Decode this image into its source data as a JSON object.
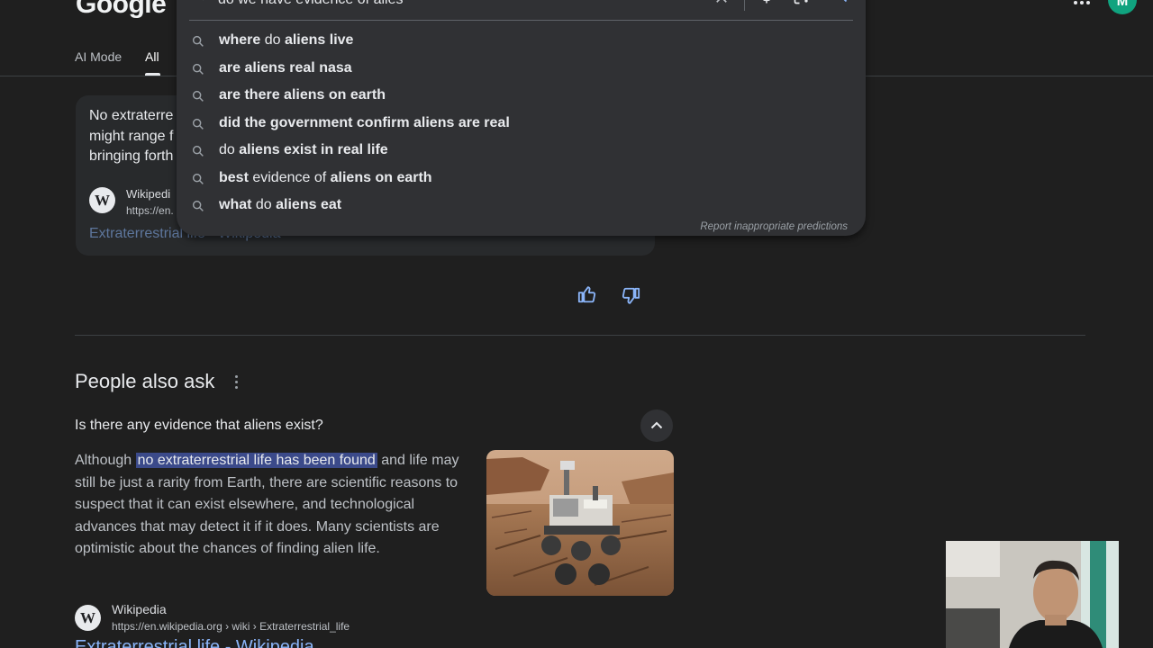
{
  "header": {
    "logo_text": "Google",
    "avatar_initial": "M"
  },
  "tabs": [
    {
      "label": "AI Mode"
    },
    {
      "label": "All"
    }
  ],
  "search": {
    "query": "do we have evidence of alies"
  },
  "suggestions": [
    {
      "parts": [
        {
          "t": "where",
          "b": true
        },
        {
          "t": " do ",
          "b": false
        },
        {
          "t": "aliens live",
          "b": true
        }
      ]
    },
    {
      "parts": [
        {
          "t": "are aliens real nasa",
          "b": true
        }
      ]
    },
    {
      "parts": [
        {
          "t": "are there aliens on earth",
          "b": true
        }
      ]
    },
    {
      "parts": [
        {
          "t": "did the government confirm aliens are real",
          "b": true
        }
      ]
    },
    {
      "parts": [
        {
          "t": "do ",
          "b": false
        },
        {
          "t": "aliens exist in real life",
          "b": true
        }
      ]
    },
    {
      "parts": [
        {
          "t": "best",
          "b": true
        },
        {
          "t": " evidence of ",
          "b": false
        },
        {
          "t": "aliens on earth",
          "b": true
        }
      ]
    },
    {
      "parts": [
        {
          "t": "what",
          "b": true
        },
        {
          "t": " do ",
          "b": false
        },
        {
          "t": "aliens eat",
          "b": true
        }
      ]
    }
  ],
  "report_text": "Report inappropriate predictions",
  "ai_overview": {
    "lines": [
      "No extraterre",
      "might range f",
      "bringing forth"
    ],
    "source_name": "Wikipedi",
    "source_url": "https://en.",
    "link_text": "Extraterrestrial life - Wikipedia"
  },
  "people_also_ask": {
    "title": "People also ask",
    "question": "Is there any evidence that aliens exist?",
    "answer_before": "Although ",
    "answer_highlight": "no extraterrestrial life has been found",
    "answer_after": " and life may still be just a rarity from Earth, there are scientific reasons to suspect that it can exist elsewhere, and technological advances that may detect it if it does. Many scientists are optimistic about the chances of finding alien life.",
    "source_name": "Wikipedia",
    "source_url": "https://en.wikipedia.org › wiki › Extraterrestrial_life",
    "link_text": "Extraterrestrial life - Wikipedia"
  },
  "colors": {
    "background": "#1f1f1f",
    "dropdown": "#303134",
    "link": "#8ab4f8",
    "highlight": "#3b4a8a",
    "avatar": "#10a37f"
  }
}
